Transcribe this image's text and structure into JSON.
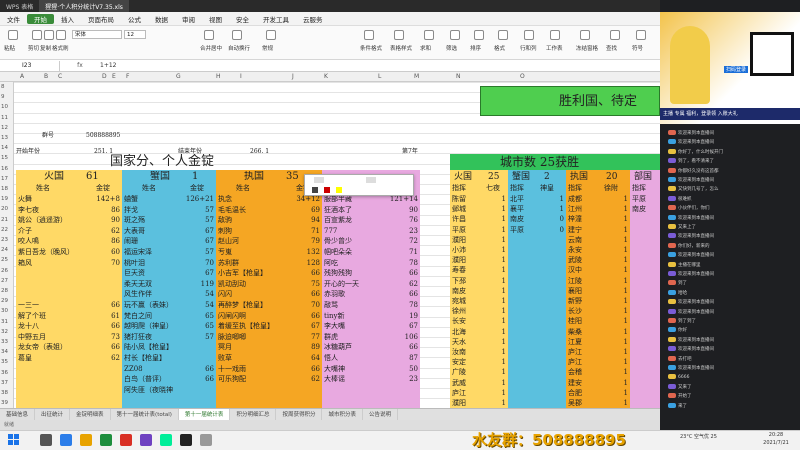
{
  "window": {
    "app_tab": "WPS 表格",
    "doc_tab": "猩猩·个人积分统计V7.35.xls",
    "colors": {
      "accent": "#3a8c3a"
    }
  },
  "menu": [
    "文件",
    "开始",
    "插入",
    "页面布局",
    "公式",
    "数据",
    "审阅",
    "视图",
    "安全",
    "开发工具",
    "云服务"
  ],
  "menu_active_index": 1,
  "ribbon": {
    "font_name": "宋体",
    "font_size": "12",
    "labels": [
      "粘贴",
      "剪切",
      "复制",
      "格式刷",
      "合并居中",
      "自动换行",
      "常规",
      "条件格式",
      "表格样式",
      "求和",
      "筛选",
      "排序",
      "格式",
      "行和列",
      "工作表",
      "冻结窗格",
      "查找",
      "符号"
    ]
  },
  "formula_bar": {
    "name_box": "I23",
    "fx": "fx",
    "formula": "1+12"
  },
  "columns": [
    "A",
    "B",
    "C",
    "D",
    "E",
    "F",
    "G",
    "H",
    "I",
    "J",
    "K",
    "L",
    "M",
    "N",
    "O"
  ],
  "rows": [
    "8",
    "9",
    "10",
    "11",
    "12",
    "13",
    "14",
    "15",
    "16",
    "17",
    "18",
    "19",
    "20",
    "21",
    "22",
    "23",
    "24",
    "25",
    "26",
    "27",
    "28",
    "29",
    "30",
    "31",
    "32",
    "33",
    "34",
    "35",
    "36",
    "37",
    "38",
    "39"
  ],
  "sheet": {
    "victory_header": "胜利国、待定",
    "group_label": "群号",
    "group_value": "508888895",
    "start_year_label": "开始年份",
    "start_year": "251. 1",
    "end_year_label": "结束年份",
    "end_year": "266. 1",
    "year_count": "第7年",
    "title": "国家分、个人金锭",
    "city_title": "城市数  25获胜",
    "factions": [
      {
        "name": "火国",
        "count": "61",
        "color": "#ffd966"
      },
      {
        "name": "蟹国",
        "count": "1",
        "color": "#5bc0de"
      },
      {
        "name": "执国",
        "count": "35",
        "color": "#f5a623"
      }
    ],
    "col_headers": {
      "name": "姓名",
      "gold": "金锭",
      "index": "指挥",
      "seven": "七夜",
      "index2": "指挥",
      "god": "神皇",
      "index3": "指挥",
      "hold": "徐附"
    },
    "fire_rows": [
      [
        "火舞",
        "142+8"
      ],
      [
        "李七夜",
        "86"
      ],
      [
        "姚公（逍遥游）",
        "90"
      ],
      [
        "介子",
        "62"
      ],
      [
        "咬人鳴",
        "86"
      ],
      [
        "紫日吾龙（晚风）",
        "60"
      ],
      [
        "箱风",
        "70"
      ],
      [
        "",
        ""
      ],
      [
        "",
        ""
      ],
      [
        "",
        ""
      ],
      [
        "一三一",
        "66"
      ],
      [
        "解了个班",
        "61"
      ],
      [
        "龙十八",
        "66"
      ],
      [
        "中野五月",
        "73"
      ],
      [
        "龙女帝（表姐）",
        "66"
      ],
      [
        "葛皇",
        "62"
      ],
      [
        "",
        ""
      ],
      [
        "",
        ""
      ],
      [
        "",
        ""
      ],
      [
        "",
        ""
      ]
    ],
    "crab_rows": [
      [
        "蛐蟹",
        "126+21"
      ],
      [
        "拌戈",
        "57"
      ],
      [
        "斑之殇",
        "57"
      ],
      [
        "大表哥",
        "67"
      ],
      [
        "闹珊",
        "67"
      ],
      [
        "福运宋泽",
        "57"
      ],
      [
        "桃叶泪",
        "70"
      ],
      [
        "巨天资",
        "67"
      ],
      [
        "柔天无双",
        "119"
      ],
      [
        "风生作伴",
        "54"
      ],
      [
        "玩不赢（表妹）",
        "54"
      ],
      [
        "梵白之间",
        "65"
      ],
      [
        "越明爬（神皇）",
        "65"
      ],
      [
        "猪打狂夜",
        "57"
      ],
      [
        "陆小凤【枪皇】",
        ""
      ],
      [
        "村长【枪皇】",
        ""
      ],
      [
        "ZZ08",
        "66"
      ],
      [
        "白鸟（普评）",
        "66"
      ],
      [
        "阿失匪（夜晓神",
        ""
      ],
      [
        "",
        ""
      ]
    ],
    "exec_rows": [
      [
        "执念",
        "34+12"
      ],
      [
        "毛毛温长",
        "69"
      ],
      [
        "敌驹",
        "94"
      ],
      [
        "刺狗",
        "71"
      ],
      [
        "赵山河",
        "79"
      ],
      [
        "亐嵬",
        "132"
      ],
      [
        "苏利群",
        "128"
      ],
      [
        "小吉军【枪皇】",
        "66"
      ],
      [
        "凯动刮动",
        "75"
      ],
      [
        "闪闪",
        "66"
      ],
      [
        "再醉梦【枪皇】",
        "70"
      ],
      [
        "闪闸闪啊",
        "66"
      ],
      [
        "着缓至执【枪皇】",
        "67"
      ],
      [
        "脉迫唧唧",
        "77"
      ],
      [
        "冥月",
        "89"
      ],
      [
        "败草",
        "64"
      ],
      [
        "十一戏雨",
        "66"
      ],
      [
        "可乐狗配",
        "62"
      ],
      [
        "",
        ""
      ],
      [
        "",
        ""
      ]
    ],
    "exec2_rows": [
      [
        "服部半藏",
        "121+14"
      ],
      [
        "狂酒本了",
        "90"
      ],
      [
        "百宣紫龙",
        "76"
      ],
      [
        "777",
        "23"
      ],
      [
        "骨少曾少",
        "72"
      ],
      [
        "帼吧朵朵",
        "71"
      ],
      [
        "阿吃",
        "78"
      ],
      [
        "残狗残狗",
        "66"
      ],
      [
        "开心的一天",
        "62"
      ],
      [
        "赤羽歌",
        "66"
      ],
      [
        "敲骂",
        "78"
      ],
      [
        "tiny新",
        "19"
      ],
      [
        "李大嘴",
        "67"
      ],
      [
        "群虎",
        "106"
      ],
      [
        "冰糖葫芦",
        "66"
      ],
      [
        "悟人",
        "87"
      ],
      [
        "大嘴神",
        "50"
      ],
      [
        "大棒谣",
        "23"
      ],
      [
        "",
        ""
      ],
      [
        "",
        ""
      ]
    ],
    "cities": [
      [
        "陈留",
        "1",
        "北平",
        "1",
        "成都",
        "1",
        "平原"
      ],
      [
        "邺城",
        "1",
        "襄平",
        "1",
        "江州",
        "1",
        "南皮"
      ],
      [
        "许昌",
        "1",
        "南皮",
        "0",
        "梓潼",
        "1",
        ""
      ],
      [
        "平原",
        "1",
        "平原",
        "0",
        "建宁",
        "1",
        ""
      ],
      [
        "濮阳",
        "1",
        "",
        "",
        "云南",
        "1",
        ""
      ],
      [
        "小沛",
        "1",
        "",
        "",
        "永安",
        "1",
        ""
      ],
      [
        "濮阳",
        "1",
        "",
        "",
        "武陵",
        "1",
        ""
      ],
      [
        "寿春",
        "1",
        "",
        "",
        "汉中",
        "1",
        ""
      ],
      [
        "下邳",
        "1",
        "",
        "",
        "江陵",
        "1",
        ""
      ],
      [
        "南皮",
        "1",
        "",
        "",
        "襄阳",
        "1",
        ""
      ],
      [
        "宛城",
        "1",
        "",
        "",
        "新野",
        "1",
        ""
      ],
      [
        "徐州",
        "1",
        "",
        "",
        "长沙",
        "1",
        ""
      ],
      [
        "长安",
        "1",
        "",
        "",
        "桂阳",
        "1",
        ""
      ],
      [
        "北海",
        "1",
        "",
        "",
        "柴桑",
        "1",
        ""
      ],
      [
        "天水",
        "1",
        "",
        "",
        "江夏",
        "1",
        ""
      ],
      [
        "汝南",
        "1",
        "",
        "",
        "庐江",
        "1",
        ""
      ],
      [
        "安定",
        "1",
        "",
        "",
        "庐江",
        "1",
        ""
      ],
      [
        "广陵",
        "1",
        "",
        "",
        "会稽",
        "1",
        ""
      ],
      [
        "武威",
        "1",
        "",
        "",
        "建安",
        "1",
        ""
      ],
      [
        "庐江",
        "1",
        "",
        "",
        "合肥",
        "1",
        ""
      ],
      [
        "濮阳",
        "1",
        "",
        "",
        "吴郡",
        "1",
        ""
      ]
    ],
    "city_factions": [
      {
        "name": "蟹国",
        "count": "2"
      },
      {
        "name": "执国",
        "count": "20"
      },
      {
        "name": "部国",
        "count": ""
      }
    ],
    "city_index_count": "25"
  },
  "sheet_tabs": [
    "基础信息",
    "出征统计",
    "金锭明细表",
    "第十一届统计表(total)",
    "第十一届统计表",
    "积分明细汇总",
    "按周获得积分",
    "城市积分表",
    "公告说明"
  ],
  "active_sheet_index": 4,
  "status_text": "就绪",
  "stream": {
    "banner_text": "扫码登录",
    "promo_text": "主播 专属 福利，登录领 入账大礼",
    "chat": [
      "欢迎来到本直播间",
      "欢迎来到本直播间",
      "你好了，什么时候开门",
      "到了，看不清来了",
      "你都好久没有这首都",
      "欢迎来到本直播间",
      "又快到几号了，怎么",
      "很难抓",
      "小伙伴们，你们",
      "欢迎来到本直播间",
      "又来上了",
      "欢迎来到本直播间",
      "你们好，新来的",
      "欢迎来到本直播间",
      "主播在哪里",
      "欢迎来到本直播间",
      "到了",
      "哈哈",
      "欢迎来到本直播间",
      "欢迎来到本直播间",
      "到了到了",
      "你好",
      "欢迎来到本直播间",
      "欢迎来到本直播间",
      "去打吧",
      "欢迎来到本直播间",
      "6666",
      "又来了",
      "开始了",
      "来了"
    ]
  },
  "taskbar": {
    "fan_group": "水友群：508888895",
    "weather": "23°C 空气优 25",
    "time": "20:28",
    "date": "2021/7/21"
  }
}
